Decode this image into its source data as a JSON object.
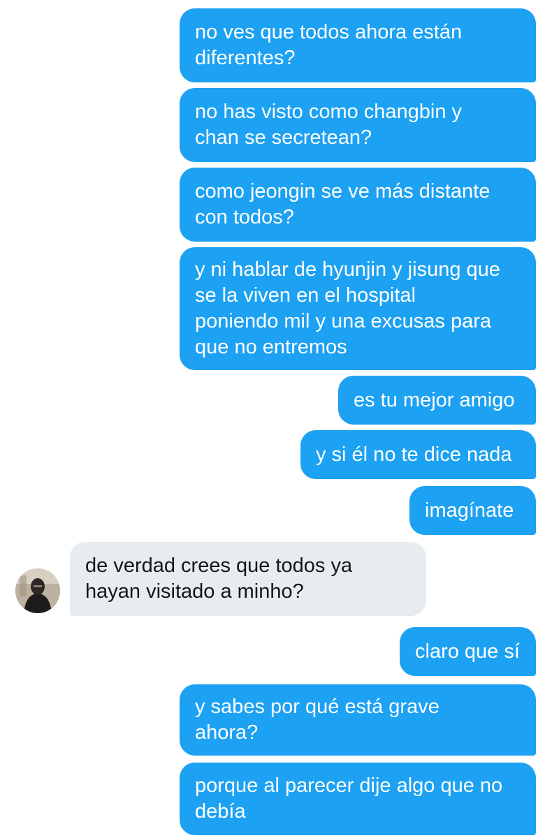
{
  "messages": [
    {
      "direction": "outgoing",
      "text": "no ves que todos ahora están\ndiferentes?"
    },
    {
      "direction": "outgoing",
      "text": "no has visto como changbin y\nchan se secretean?"
    },
    {
      "direction": "outgoing",
      "text": "como jeongin se ve más distante\ncon todos?"
    },
    {
      "direction": "outgoing",
      "text": "y ni hablar de hyunjin y jisung que\nse la viven en el hospital\nponiendo mil y una excusas para\nque no entremos"
    },
    {
      "direction": "outgoing",
      "text": "es tu mejor amigo"
    },
    {
      "direction": "outgoing",
      "text": "y si él no te dice nada"
    },
    {
      "direction": "outgoing",
      "text": "imagínate"
    },
    {
      "direction": "incoming",
      "text": "de verdad crees que todos ya\nhayan visitado a minho?"
    },
    {
      "direction": "outgoing",
      "text": "claro que sí"
    },
    {
      "direction": "outgoing",
      "text": "y sabes por qué está grave\nahora?"
    },
    {
      "direction": "outgoing",
      "text": "porque al parecer dije algo que no\ndebía"
    }
  ],
  "colors": {
    "outgoing_bubble": "#1da1f2",
    "incoming_bubble": "#e6ecf0",
    "background": "#ffffff"
  },
  "icons": {
    "sender_avatar": "avatar-photo"
  }
}
